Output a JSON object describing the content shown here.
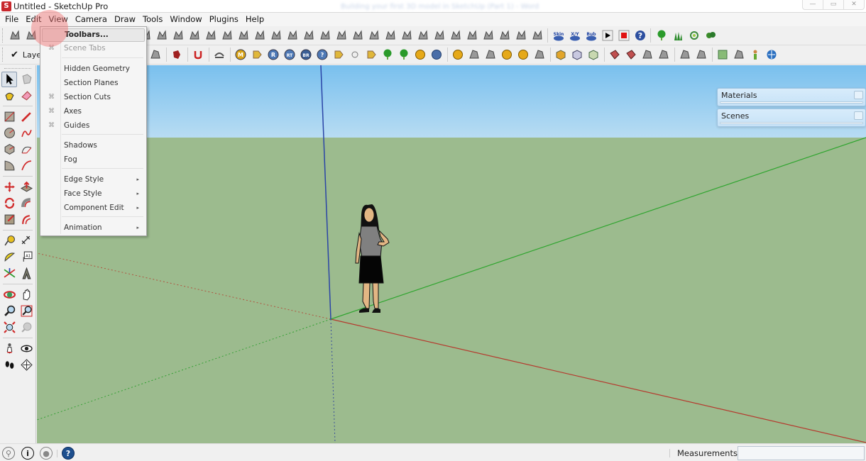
{
  "window": {
    "title": "Untitled - SketchUp Pro",
    "background_title": "Building your first 3D model in SketchUp (Part 1) - Word",
    "controls": [
      "minimize",
      "maximize",
      "close"
    ]
  },
  "menubar": [
    "File",
    "Edit",
    "View",
    "Camera",
    "Draw",
    "Tools",
    "Window",
    "Plugins",
    "Help"
  ],
  "view_menu": {
    "items": [
      {
        "label": "Toolbars...",
        "checked": false,
        "disabled": false,
        "submenu": false,
        "highlighted": true
      },
      {
        "label": "Scene Tabs",
        "checked": true,
        "disabled": true,
        "submenu": false
      },
      {
        "label": "Hidden Geometry",
        "checked": false,
        "disabled": false,
        "submenu": false
      },
      {
        "label": "Section Planes",
        "checked": false,
        "disabled": false,
        "submenu": false
      },
      {
        "label": "Section Cuts",
        "checked": true,
        "disabled": false,
        "submenu": false
      },
      {
        "label": "Axes",
        "checked": true,
        "disabled": false,
        "submenu": false
      },
      {
        "label": "Guides",
        "checked": true,
        "disabled": false,
        "submenu": false
      },
      {
        "label": "Shadows",
        "checked": false,
        "disabled": false,
        "submenu": false
      },
      {
        "label": "Fog",
        "checked": false,
        "disabled": false,
        "submenu": false
      },
      {
        "label": "Edge Style",
        "checked": false,
        "disabled": false,
        "submenu": true
      },
      {
        "label": "Face Style",
        "checked": false,
        "disabled": false,
        "submenu": true
      },
      {
        "label": "Component Edit",
        "checked": false,
        "disabled": false,
        "submenu": true
      },
      {
        "label": "Animation",
        "checked": false,
        "disabled": false,
        "submenu": true
      }
    ],
    "check_glyph": "⌘",
    "arrow_glyph": "▸"
  },
  "toolbar2": {
    "layer_check": "✔",
    "layer_label": "Layer"
  },
  "toolbar1_icons": [
    "rotated-rectangle-icon",
    "freehand-icon",
    "orbit-icon",
    "pushpull-icon",
    "fillet-icon",
    "chamfer-icon",
    "line-icon",
    "curve-icon",
    "section-icon",
    "cone-icon",
    "extrude-icon",
    "grid-icon",
    "sphere-icon",
    "loft-icon",
    "shell-icon",
    "stairs-icon",
    "sweep-icon",
    "joint-icon",
    "joint2-icon",
    "joint3-icon",
    "dome-icon",
    "rails-icon",
    "frame-icon",
    "anchor-icon",
    "lattice-icon",
    "weave-icon",
    "stack-icon",
    "columns-icon",
    "twist-icon",
    "spiral-icon",
    "slats-icon",
    "mesh-icon",
    "cushion-icon",
    "skin-icon",
    "xy-icon",
    "bub-icon",
    "play-icon",
    "stop-icon",
    "help-icon",
    "tree-icon",
    "grass-icon",
    "shrub-icon",
    "bush-icon"
  ],
  "toolbar1_labels": {
    "skin": "Skin",
    "xy": "X/Y",
    "bub": "Bub"
  },
  "toolbar2_icons": [
    "pin-icon",
    "star-icon",
    "sandbox-icon",
    "magnet-icon",
    "arc-bridge-icon",
    "m-icon",
    "tag-icon",
    "r-icon",
    "rt-icon",
    "br-icon",
    "question-icon",
    "tag2-icon",
    "dot-icon",
    "insect-icon",
    "landscape-icon",
    "landscape2-icon",
    "target-icon",
    "pause-icon",
    "yellow-ball-icon",
    "bell-icon",
    "flag-icon",
    "half-dome-icon",
    "sun-icon",
    "hat-icon",
    "box-yellow-icon",
    "box-blue-icon",
    "box-green-icon",
    "face-red-icon",
    "face-outline-icon",
    "pyramid-icon",
    "cube-icon",
    "diamond-icon",
    "cut-icon",
    "map-icon",
    "tile-icon",
    "person-icon",
    "globe-icon"
  ],
  "toolbar2_labels": {
    "m": "M",
    "r": "R",
    "rt": "RT",
    "br": "BR",
    "q": "?"
  },
  "left_tools": [
    [
      "select-tool",
      "component-tool"
    ],
    [
      "paint-bucket-tool",
      "eraser-tool"
    ],
    [
      "rectangle-tool",
      "line-tool"
    ],
    [
      "circle-tool",
      "freehand-tool"
    ],
    [
      "polygon-tool",
      "arc-tool"
    ],
    [
      "pie-tool",
      "two-point-arc-tool"
    ],
    [
      "move-tool",
      "push-pull-tool"
    ],
    [
      "rotate-tool",
      "follow-me-tool"
    ],
    [
      "scale-tool",
      "offset-tool"
    ],
    [
      "tape-measure-tool",
      "dimension-tool"
    ],
    [
      "protractor-tool",
      "text-tool"
    ],
    [
      "axes-tool",
      "3d-text-tool"
    ],
    [
      "orbit-tool",
      "pan-tool"
    ],
    [
      "zoom-tool",
      "zoom-window-tool"
    ],
    [
      "zoom-extents-tool",
      "previous-view-tool"
    ],
    [
      "position-camera-tool",
      "look-around-tool"
    ],
    [
      "walk-tool",
      "section-plane-tool"
    ]
  ],
  "trays": [
    {
      "label": "Materials"
    },
    {
      "label": "Scenes"
    }
  ],
  "statusbar": {
    "icons": [
      "geo-location-icon",
      "credits-icon",
      "account-icon",
      "help-icon"
    ],
    "measurements_label": "Measurements",
    "measurements_value": ""
  },
  "colors": {
    "sky_top": "#79c0ee",
    "ground": "#9cbb8e",
    "axis_red": "#c0362c",
    "axis_green": "#2ea82e",
    "axis_blue": "#2540a8",
    "tray": "#cfe7f9"
  }
}
